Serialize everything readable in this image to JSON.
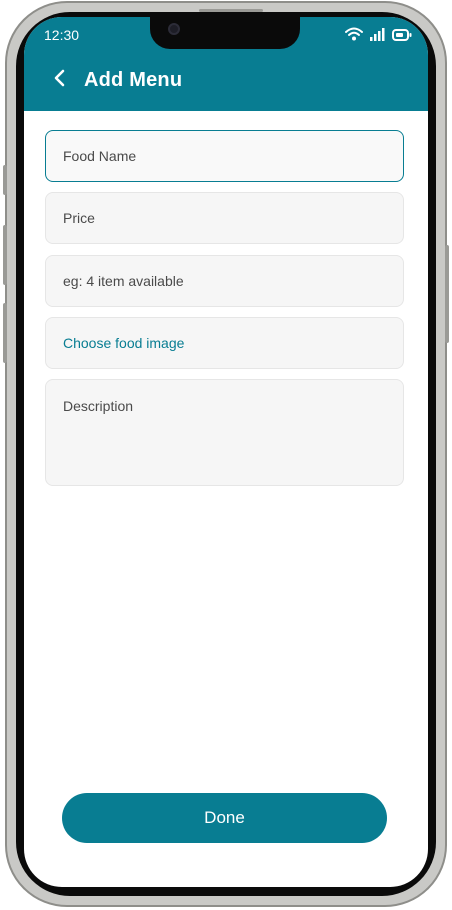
{
  "status_bar": {
    "time": "12:30",
    "icons": [
      "wifi-icon",
      "signal-icon",
      "battery-icon"
    ]
  },
  "header": {
    "title": "Add Menu",
    "back_icon": "chevron-left-icon"
  },
  "form": {
    "food_name": {
      "placeholder": "Food Name"
    },
    "price": {
      "placeholder": "Price"
    },
    "availability": {
      "placeholder": "eg: 4 item available"
    },
    "image": {
      "label": "Choose food image"
    },
    "description": {
      "placeholder": "Description"
    }
  },
  "done_label": "Done",
  "colors": {
    "accent": "#087d92",
    "field_background": "#f6f6f6",
    "field_border": "#e6e6e6",
    "text": "#4a4a4a"
  }
}
